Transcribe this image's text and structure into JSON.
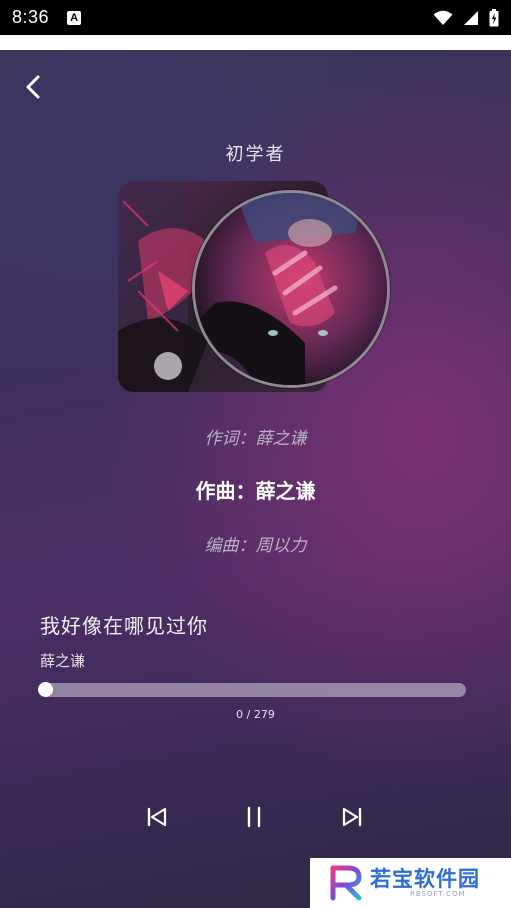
{
  "status_bar": {
    "time": "8:36",
    "notification_icon_letter": "A",
    "icons": [
      "wifi-icon",
      "cell-signal-icon",
      "battery-icon"
    ]
  },
  "header": {
    "back_icon": "chevron-left-icon",
    "title": "初学者"
  },
  "credits": {
    "lyricist": "作词：薛之谦",
    "composer": "作曲：薛之谦",
    "arranger": "编曲：周以力"
  },
  "song": {
    "title": "我好像在哪见过你",
    "artist": "薛之谦"
  },
  "progress": {
    "label": "0 / 279",
    "fraction": 0.0
  },
  "controls": {
    "previous_icon": "skip-previous-icon",
    "pause_icon": "pause-icon",
    "next_icon": "skip-next-icon"
  },
  "watermark": {
    "name": "若宝软件园",
    "sub": "RBSOFT.COM"
  },
  "colors": {
    "background_top": "#3c3458",
    "background_accent": "#8c3278",
    "text_primary": "#ffffff",
    "text_secondary": "#b8b3c4",
    "watermark_blue": "#2b6fd6"
  }
}
